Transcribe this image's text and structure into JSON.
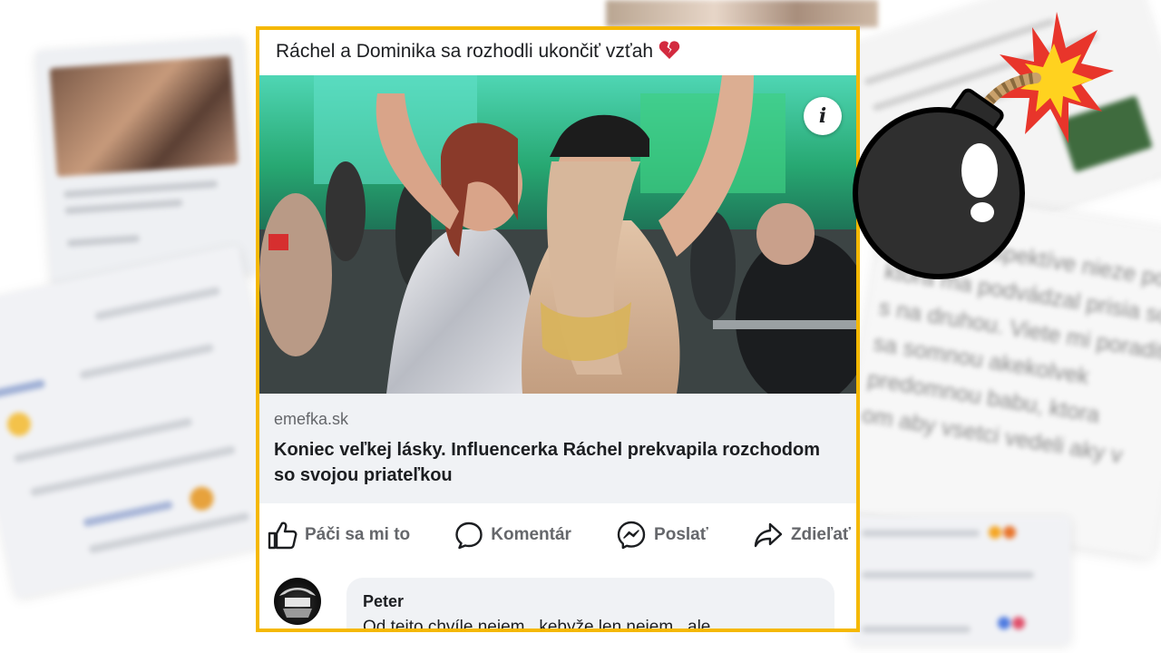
{
  "post": {
    "title": "Ráchel a Dominika sa rozhodli ukončiť vzťah",
    "title_emoji": "broken-heart-icon",
    "info_label": "i",
    "link": {
      "domain": "emefka.sk",
      "headline": "Koniec veľkej lásky. Influencerka Ráchel prekvapila rozchodom so svojou priateľkou"
    },
    "actions": {
      "like": "Páči sa mi to",
      "comment": "Komentár",
      "send": "Poslať",
      "share": "Zdieľať"
    },
    "comment": {
      "author": "Peter",
      "text": "Od tejto chvíle nejem , kebyže len nejem , ale"
    }
  },
  "colors": {
    "frame": "#f5b800",
    "action_text": "#65676b",
    "link_bg": "#f0f2f5"
  }
}
